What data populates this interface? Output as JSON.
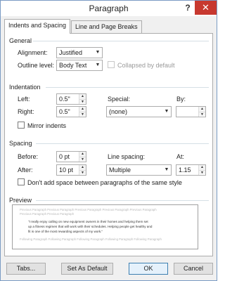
{
  "window": {
    "title": "Paragraph",
    "help_glyph": "?",
    "close_glyph": "✕"
  },
  "tabs": [
    {
      "label": "Indents and Spacing",
      "active": true
    },
    {
      "label": "Line and Page Breaks",
      "active": false
    }
  ],
  "general": {
    "heading": "General",
    "alignment_label": "Alignment:",
    "alignment_value": "Justified",
    "outline_label": "Outline level:",
    "outline_value": "Body Text",
    "collapsed_label": "Collapsed by default",
    "collapsed_checked": false
  },
  "indentation": {
    "heading": "Indentation",
    "left_label": "Left:",
    "left_value": "0.5\"",
    "right_label": "Right:",
    "right_value": "0.5\"",
    "special_label": "Special:",
    "special_value": "(none)",
    "by_label": "By:",
    "by_value": "",
    "mirror_label": "Mirror indents",
    "mirror_checked": false
  },
  "spacing": {
    "heading": "Spacing",
    "before_label": "Before:",
    "before_value": "0 pt",
    "after_label": "After:",
    "after_value": "10 pt",
    "line_spacing_label": "Line spacing:",
    "line_spacing_value": "Multiple",
    "at_label": "At:",
    "at_value": "1.15",
    "dont_add_label": "Don't add space between paragraphs of the same style",
    "dont_add_checked": false
  },
  "preview": {
    "heading": "Preview",
    "prev_line_1": "Previous Paragraph Previous Paragraph Previous Paragraph Previous Paragraph Previous Paragraph",
    "prev_line_2": "Previous Paragraph Previous Paragraph",
    "main_line_1": "\"I really enjoy calling on new equipment owners in their homes and helping them set",
    "main_line_2": "up a fitness regimen that will work with their schedules. Helping people get healthy and",
    "main_line_3": "fit is one of the most rewarding aspects of my work.\"",
    "next_line_1": "Following Paragraph Following Paragraph Following Paragraph Following Paragraph Following Paragraph"
  },
  "footer": {
    "tabs_button": "Tabs...",
    "set_default_button": "Set As Default",
    "ok_button": "OK",
    "cancel_button": "Cancel"
  },
  "colors": {
    "close_button": "#c7382f",
    "default_button_border": "#3c7fb1",
    "window_border": "#7a9bc4"
  }
}
